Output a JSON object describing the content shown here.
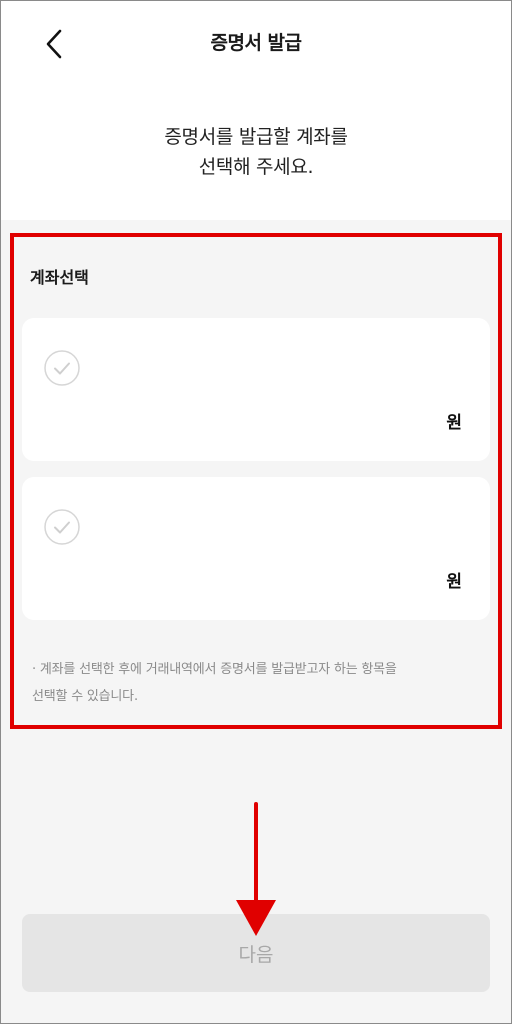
{
  "header": {
    "title": "증명서 발급",
    "back_icon": "chevron-left-icon"
  },
  "guide": {
    "line1": "증명서를 발급할 계좌를",
    "line2": "선택해 주세요."
  },
  "account_section": {
    "label": "계좌선택",
    "accounts": [
      {
        "unit": "원",
        "check_icon": "check-circle-icon"
      },
      {
        "unit": "원",
        "check_icon": "check-circle-icon"
      }
    ],
    "notice_line1": "· 계좌를 선택한 후에 거래내역에서 증명서를 발급받고자 하는 항목을",
    "notice_line2": "선택할 수 있습니다."
  },
  "footer": {
    "next_label": "다음"
  },
  "colors": {
    "highlight_border": "#e00000",
    "arrow": "#e00000",
    "disabled_button_bg": "#e5e5e5",
    "disabled_button_text": "#a8a8a8"
  }
}
